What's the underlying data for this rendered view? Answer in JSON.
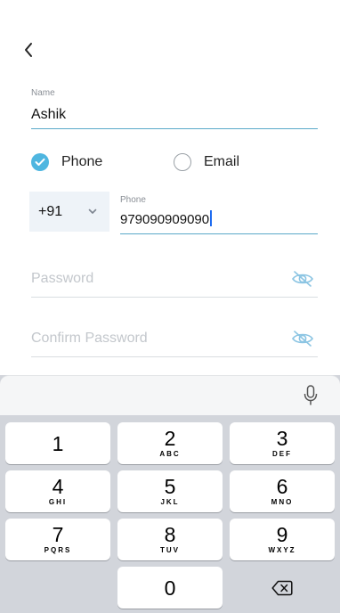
{
  "form": {
    "name_label": "Name",
    "name_value": "Ashik",
    "contact_method": {
      "options": [
        {
          "label": "Phone",
          "selected": true
        },
        {
          "label": "Email",
          "selected": false
        }
      ]
    },
    "country_code": "+91",
    "phone_label": "Phone",
    "phone_value": "979090909090",
    "password_placeholder": "Password",
    "confirm_password_placeholder": "Confirm Password"
  },
  "keyboard": {
    "keys": [
      {
        "digit": "1",
        "letters": ""
      },
      {
        "digit": "2",
        "letters": "ABC"
      },
      {
        "digit": "3",
        "letters": "DEF"
      },
      {
        "digit": "4",
        "letters": "GHI"
      },
      {
        "digit": "5",
        "letters": "JKL"
      },
      {
        "digit": "6",
        "letters": "MNO"
      },
      {
        "digit": "7",
        "letters": "PQRS"
      },
      {
        "digit": "8",
        "letters": "TUV"
      },
      {
        "digit": "9",
        "letters": "WXYZ"
      },
      {
        "digit": "0",
        "letters": ""
      }
    ]
  },
  "icons": {
    "back": "chevron-left-icon",
    "check": "check-icon",
    "dropdown": "chevron-down-icon",
    "eye_hidden": "eye-off-icon",
    "mic": "microphone-icon",
    "delete": "backspace-icon"
  },
  "colors": {
    "accent": "#4fb6e0",
    "underline_active": "#5aa9c9",
    "placeholder": "#c3c7cc",
    "keyboard_bg": "#d2d5db"
  }
}
